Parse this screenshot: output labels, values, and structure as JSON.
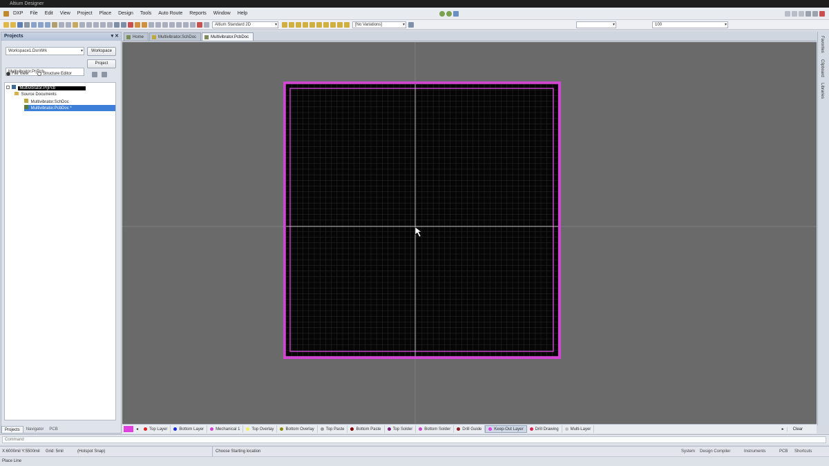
{
  "window": {
    "title": "Altium Designer"
  },
  "menu": [
    "DXP",
    "File",
    "Edit",
    "View",
    "Project",
    "Place",
    "Design",
    "Tools",
    "Auto Route",
    "Reports",
    "Window",
    "Help"
  ],
  "toolbar": {
    "view_config": "Altium Standard 2D",
    "variations": "[No Variations]",
    "unit_combo": "",
    "zoom_combo": "100"
  },
  "projects_panel": {
    "title": "Projects",
    "workspace_combo": "Workspace1.DsnWrk",
    "workspace_button": "Workspace",
    "project_field": "Multivibrator.PrjPcb",
    "project_button": "Project",
    "file_view": "File View",
    "structure_editor": "Structure Editor",
    "tree": {
      "root": "Multivibrator.PrjPcb",
      "folder": "Source Documents",
      "schematic": "Multivibrator.SchDoc",
      "pcb": "Multivibrator.PcbDoc *"
    },
    "bottom_tabs": [
      "Projects",
      "Navigator",
      "PCB"
    ]
  },
  "doc_tabs": [
    {
      "label": "Home",
      "active": false
    },
    {
      "label": "Multivibrator.SchDoc",
      "active": false
    },
    {
      "label": "Multivibrator.PcbDoc",
      "active": true
    }
  ],
  "right_strip": [
    "Favorites",
    "Clipboard",
    "Libraries"
  ],
  "layers": [
    {
      "name": "Top Layer",
      "color": "#e02020"
    },
    {
      "name": "Bottom Layer",
      "color": "#1a2ad8"
    },
    {
      "name": "Mechanical 1",
      "color": "#d040d0"
    },
    {
      "name": "Top Overlay",
      "color": "#f2f060"
    },
    {
      "name": "Bottom Overlay",
      "color": "#8a8a00"
    },
    {
      "name": "Top Paste",
      "color": "#9a9a9a"
    },
    {
      "name": "Bottom Paste",
      "color": "#800000"
    },
    {
      "name": "Top Solder",
      "color": "#7a207a"
    },
    {
      "name": "Bottom Solder",
      "color": "#d040d0"
    },
    {
      "name": "Drill Guide",
      "color": "#902020"
    },
    {
      "name": "Keep-Out Layer",
      "color": "#e040e0"
    },
    {
      "name": "Drill Drawing",
      "color": "#e02050"
    },
    {
      "name": "Multi-Layer",
      "color": "#c0c0c0"
    }
  ],
  "layer_bar_right": "Clear",
  "command_line": "Command",
  "status": {
    "coords": "X:6000mil Y:5500mil",
    "grid": "Grid: 5mil",
    "snap": "(Hotspot Snap)",
    "message": "Choose Starting location",
    "right": [
      "System",
      "Design Compiler",
      "Instruments",
      "PCB",
      "Shortcuts"
    ]
  },
  "status2": "Place Line",
  "colors": {
    "canvas_bg": "#6a6a6a",
    "board_bg": "#050505",
    "keepout": "#d046d0"
  }
}
